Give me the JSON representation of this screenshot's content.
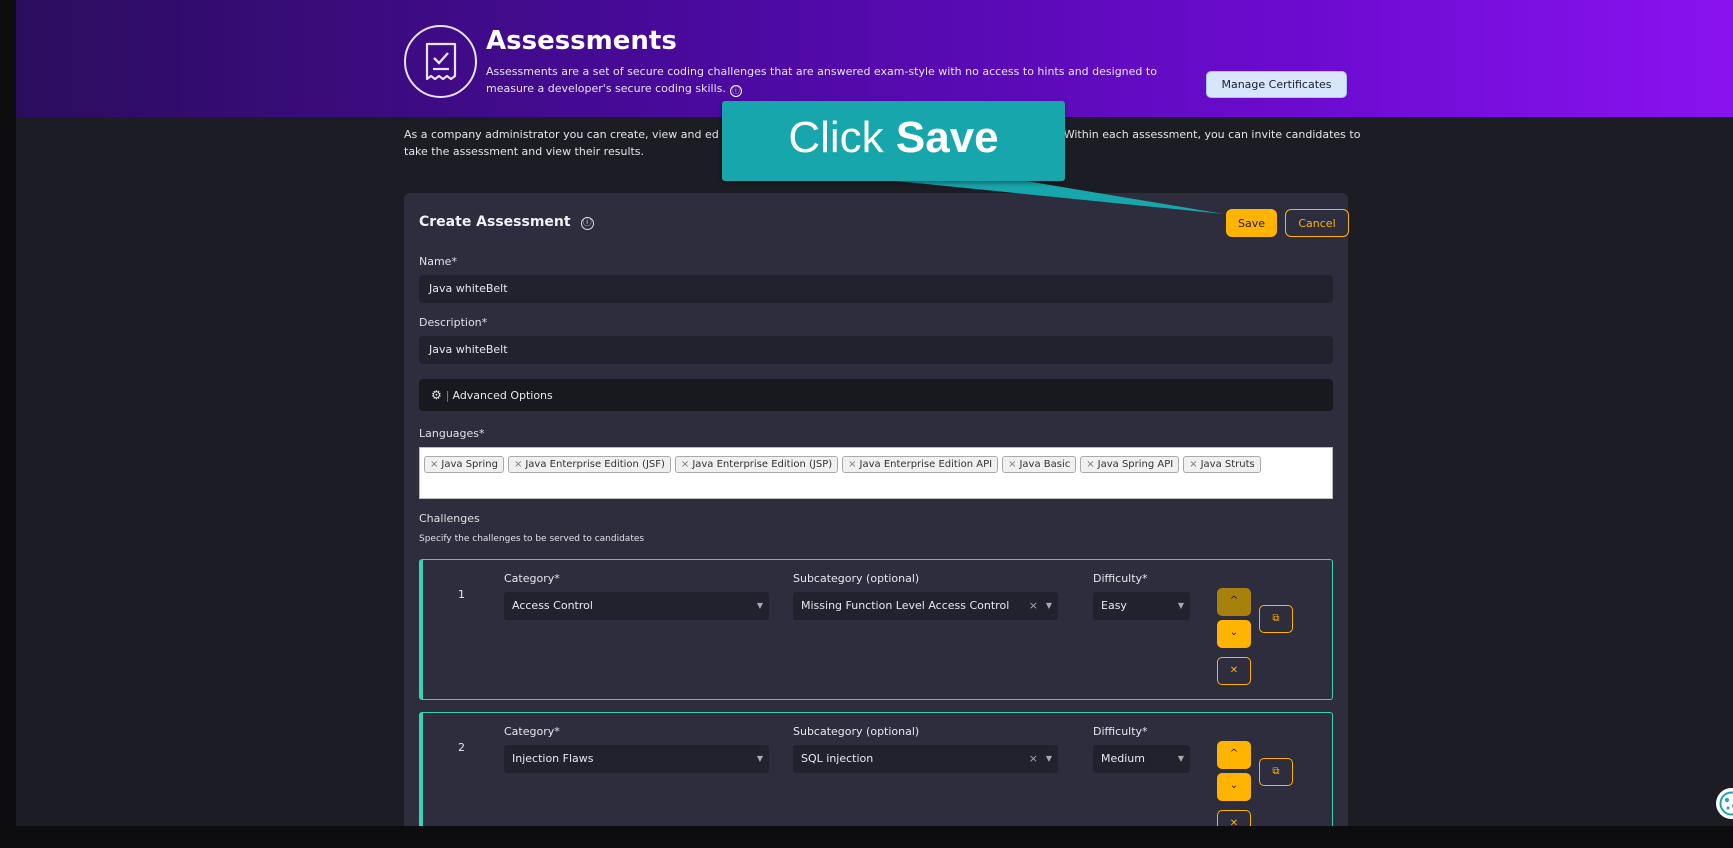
{
  "header": {
    "title": "Assessments",
    "description": "Assessments are a set of secure coding challenges that are answered exam-style with no access to hints and designed to measure a developer's secure coding skills.",
    "manage_certificates_label": "Manage Certificates"
  },
  "intro": {
    "text_left": "As a company administrator you can create, view and ed",
    "text_right": ". Within each assessment, you can invite candidates to",
    "text_line2": "take the assessment and view their results."
  },
  "form": {
    "title": "Create Assessment",
    "save_label": "Save",
    "cancel_label": "Cancel",
    "name_label": "Name*",
    "name_value": "Java whiteBelt",
    "description_label": "Description*",
    "description_value": "Java whiteBelt",
    "advanced_options_label": "Advanced Options",
    "languages_label": "Languages*",
    "languages": [
      "Java Spring",
      "Java Enterprise Edition (JSF)",
      "Java Enterprise Edition (JSP)",
      "Java Enterprise Edition API",
      "Java Basic",
      "Java Spring API",
      "Java Struts"
    ],
    "challenges_label": "Challenges",
    "challenges_hint": "Specify the challenges to be served to candidates",
    "challenges": [
      {
        "number": "1",
        "category_label": "Category*",
        "category": "Access Control",
        "subcategory_label": "Subcategory (optional)",
        "subcategory": "Missing Function Level Access Control",
        "difficulty_label": "Difficulty*",
        "difficulty": "Easy"
      },
      {
        "number": "2",
        "category_label": "Category*",
        "category": "Injection Flaws",
        "subcategory_label": "Subcategory (optional)",
        "subcategory": "SQL injection",
        "difficulty_label": "Difficulty*",
        "difficulty": "Medium"
      }
    ]
  },
  "callout": {
    "prefix": "Click",
    "emphasis": "Save"
  },
  "icons": {
    "info": "ⓘ",
    "up": "^",
    "down": "⌄",
    "remove": "✕",
    "copy": "⧉",
    "clear": "×",
    "caret": "▼",
    "gear": "⚙"
  },
  "colors": {
    "accent": "#ffb400",
    "teal_border": "#39d3b4",
    "callout": "#16a6ac"
  }
}
